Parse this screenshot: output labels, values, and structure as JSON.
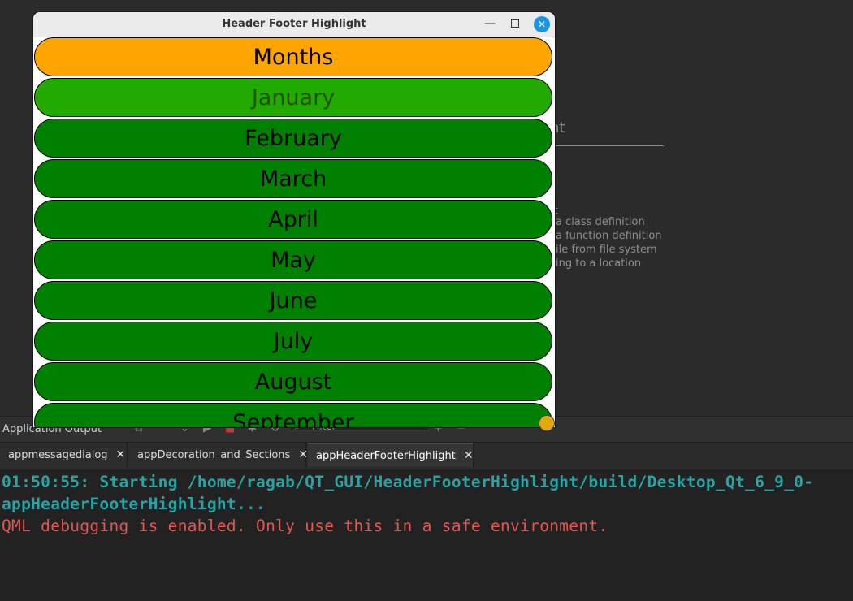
{
  "window": {
    "title": "Header Footer Highlight",
    "minimize": "—",
    "close": "✕"
  },
  "list": {
    "header": "Months",
    "items": [
      "January",
      "February",
      "March",
      "April",
      "May",
      "June",
      "July",
      "August",
      "September"
    ],
    "highlighted_index": 0,
    "colors": {
      "header": "#ffa500",
      "highlight": "#22aa00",
      "normal": "#008000"
    }
  },
  "background": {
    "heading_fragment": "nt",
    "lines": [
      "a class definition",
      "a function definition",
      "ile from file system",
      "ing to a location"
    ]
  },
  "output_pane": {
    "title": "Application Output",
    "filter_placeholder": "Filter",
    "tabs": [
      {
        "label": "appmessagedialog"
      },
      {
        "label": "appDecoration_and_Sections"
      },
      {
        "label": "appHeaderFooterHighlight"
      }
    ],
    "active_tab": 2,
    "tab_close": "✕",
    "console": [
      {
        "text": "01:50:55: Starting /home/ragab/QT_GUI/HeaderFooterHighlight/build/Desktop_Qt_6_9_0-",
        "kind": "start"
      },
      {
        "text": "appHeaderFooterHighlight...",
        "kind": "start"
      },
      {
        "text": "QML debugging is enabled. Only use this in a safe environment.",
        "kind": "warn"
      }
    ]
  }
}
